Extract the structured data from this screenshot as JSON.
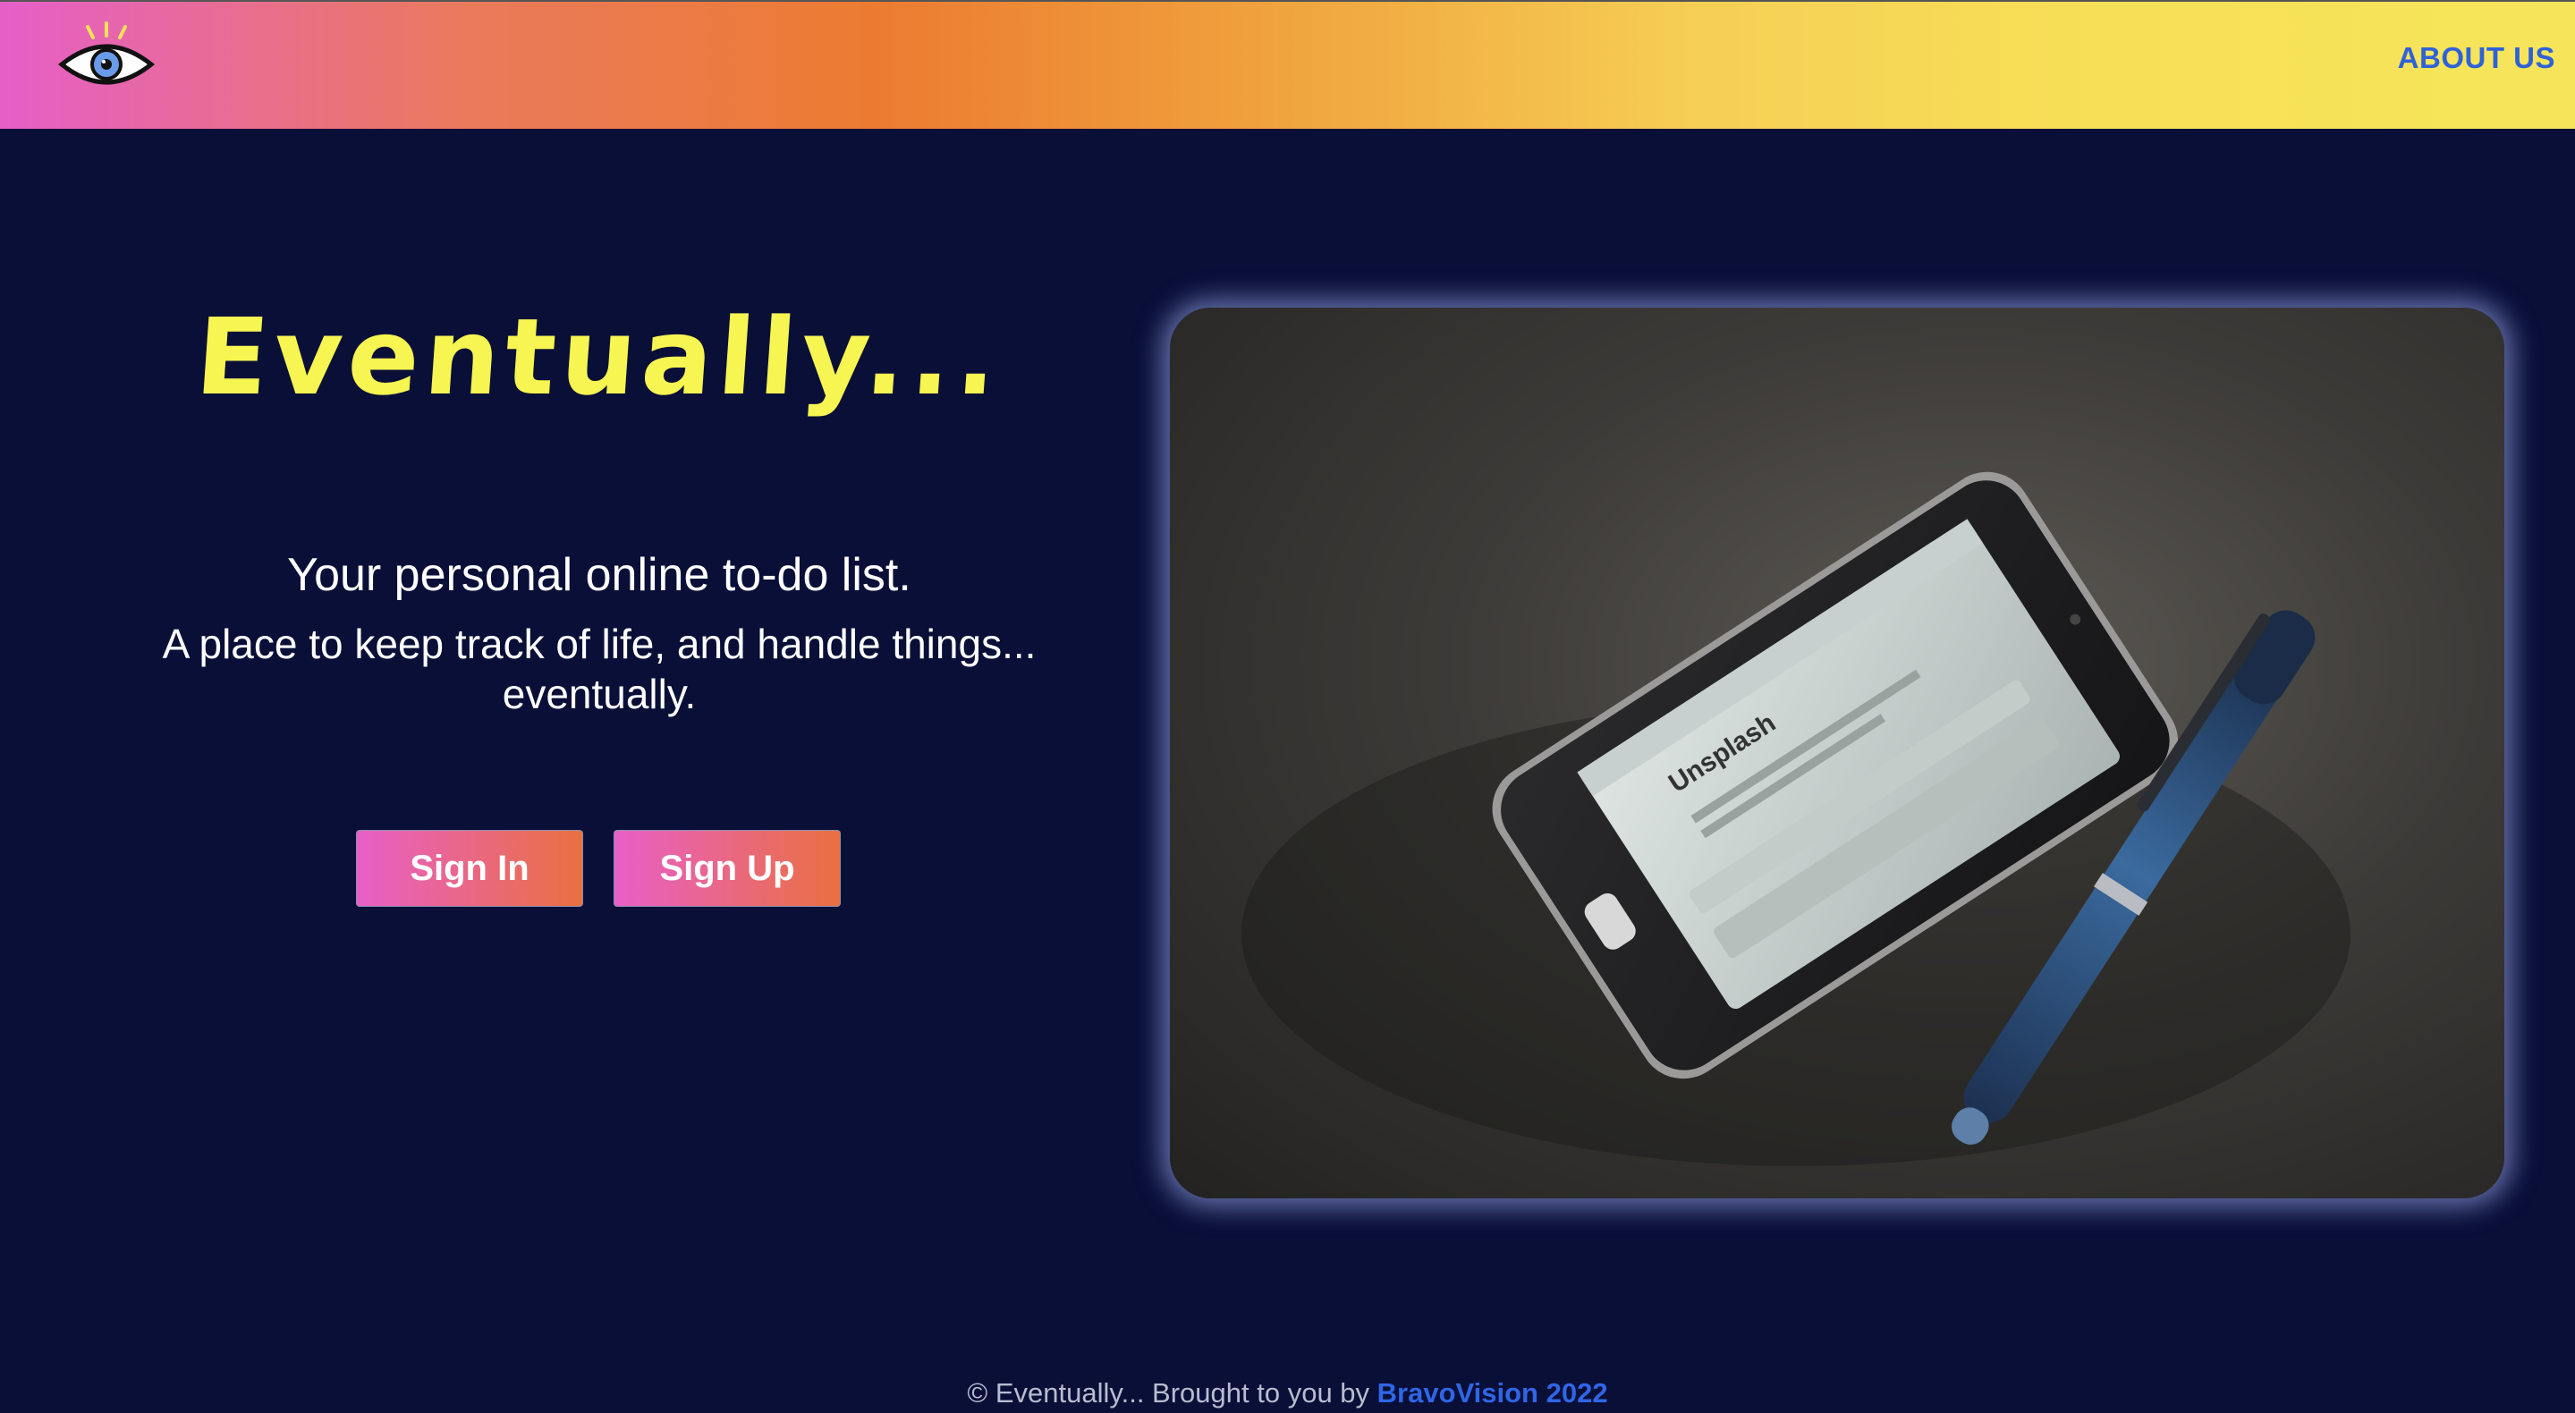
{
  "nav": {
    "logo_icon": "eye-icon",
    "about_label": "ABOUT US"
  },
  "hero": {
    "title": "Eventually...",
    "tagline": "Your personal online to-do list.",
    "subtagline_line1": "A place to keep track of life, and handle things...",
    "subtagline_line2": "eventually.",
    "signin_label": "Sign In",
    "signup_label": "Sign Up"
  },
  "photo": {
    "phone_screen_brand": "Unsplash",
    "phone_screen_url": "https://unsplash.com"
  },
  "footer": {
    "text": "© Eventually... Brought to you by ",
    "credit": "BravoVision 2022"
  },
  "colors": {
    "background": "#0a0f38",
    "title": "#f6f552",
    "link": "#2f62d8",
    "button_start": "#e85fc8",
    "button_end": "#ea7040"
  }
}
